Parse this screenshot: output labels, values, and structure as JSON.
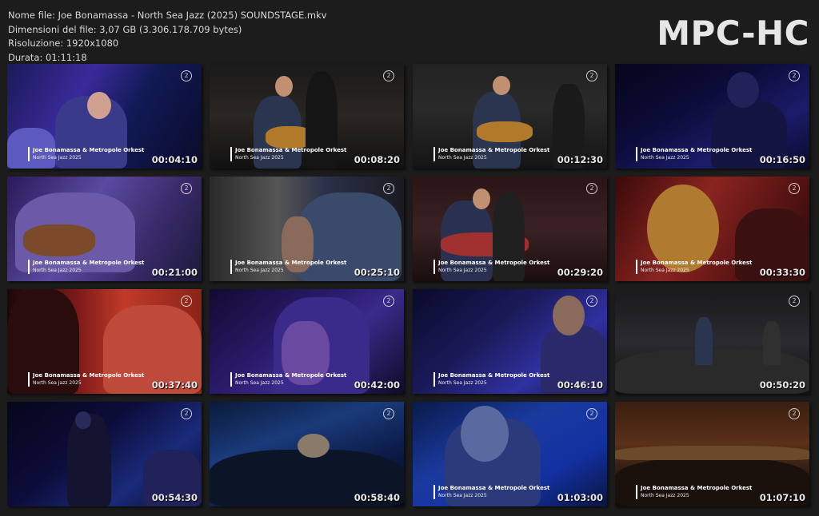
{
  "header": {
    "file_name": "Nome file: Joe Bonamassa - North Sea Jazz (2025) SOUNDSTAGE.mkv",
    "file_size": "Dimensioni del file: 3,07 GB (3.306.178.709 bytes)",
    "resolution": "Risoluzione: 1920x1080",
    "duration": "Durata: 01:11:18",
    "brand": "MPC-HC"
  },
  "overlay": {
    "channel": "2",
    "line1": "Joe Bonamassa & Metropole Orkest",
    "line2": "North Sea Jazz 2025"
  },
  "thumbnails": [
    {
      "time": "00:04:10",
      "bg": "linear-gradient(120deg,#1a1a5a 0%,#3a2a9a 35%,#111a55 60%,#0a0a2a 100%)",
      "lower": true
    },
    {
      "time": "00:08:20",
      "bg": "linear-gradient(180deg,#1a1a1a 0%,#2a2622 50%,#111 100%)",
      "lower": true
    },
    {
      "time": "00:12:30",
      "bg": "linear-gradient(180deg,#222 0%,#2a2a2a 40%,#141414 100%)",
      "lower": true
    },
    {
      "time": "00:16:50",
      "bg": "linear-gradient(150deg,#05051a 0%,#0c0c3a 40%,#1b1b6a 70%,#0a0a2a 100%)",
      "lower": true
    },
    {
      "time": "00:21:00",
      "bg": "linear-gradient(120deg,#2a1a5a 0%,#5a4aa0 40%,#3a2a6a 70%,#1a1a3a 100%)",
      "lower": true
    },
    {
      "time": "00:25:10",
      "bg": "linear-gradient(90deg,#2a2a2a 0%,#555 35%,#2a3048 60%,#1a1a20 100%)",
      "lower": true
    },
    {
      "time": "00:29:20",
      "bg": "linear-gradient(180deg,#2a1416 0%,#3a2224 50%,#1a0e0e 100%)",
      "lower": true
    },
    {
      "time": "00:33:30",
      "bg": "linear-gradient(120deg,#3a0a0a 0%,#8a2420 40%,#5a1414 70%,#2a0808 100%)",
      "lower": true
    },
    {
      "time": "00:37:40",
      "bg": "linear-gradient(90deg,#1a0808 0%,#7a1818 35%,#c03a2a 60%,#8a2418 100%)",
      "lower": true
    },
    {
      "time": "00:42:00",
      "bg": "linear-gradient(140deg,#120a30 0%,#2a1a6a 40%,#3a2a8a 60%,#100a28 100%)",
      "lower": true
    },
    {
      "time": "00:46:10",
      "bg": "linear-gradient(140deg,#0a0a2a 0%,#1a1a5a 40%,#3030a0 70%,#15154a 100%)",
      "lower": true
    },
    {
      "time": "00:50:20",
      "bg": "linear-gradient(180deg,#1a1a1c 0%,#2a2a30 50%,#101012 100%)",
      "lower": false
    },
    {
      "time": "00:54:30",
      "bg": "linear-gradient(140deg,#06061a 0%,#0c0c3a 40%,#1a2a7a 70%,#0a0a2a 100%)",
      "lower": false
    },
    {
      "time": "00:58:40",
      "bg": "linear-gradient(160deg,#0a1a3a 0%,#1a3a7a 35%,#0c1c4a 65%,#050a1a 100%)",
      "lower": false
    },
    {
      "time": "01:03:00",
      "bg": "linear-gradient(150deg,#0a1a4a 0%,#1a3aa0 40%,#1230a0 70%,#0a1440 100%)",
      "lower": true
    },
    {
      "time": "01:07:10",
      "bg": "linear-gradient(180deg,#3a1e10 0%,#5a3018 40%,#2a1a12 70%,#140c08 100%)",
      "lower": true
    }
  ]
}
